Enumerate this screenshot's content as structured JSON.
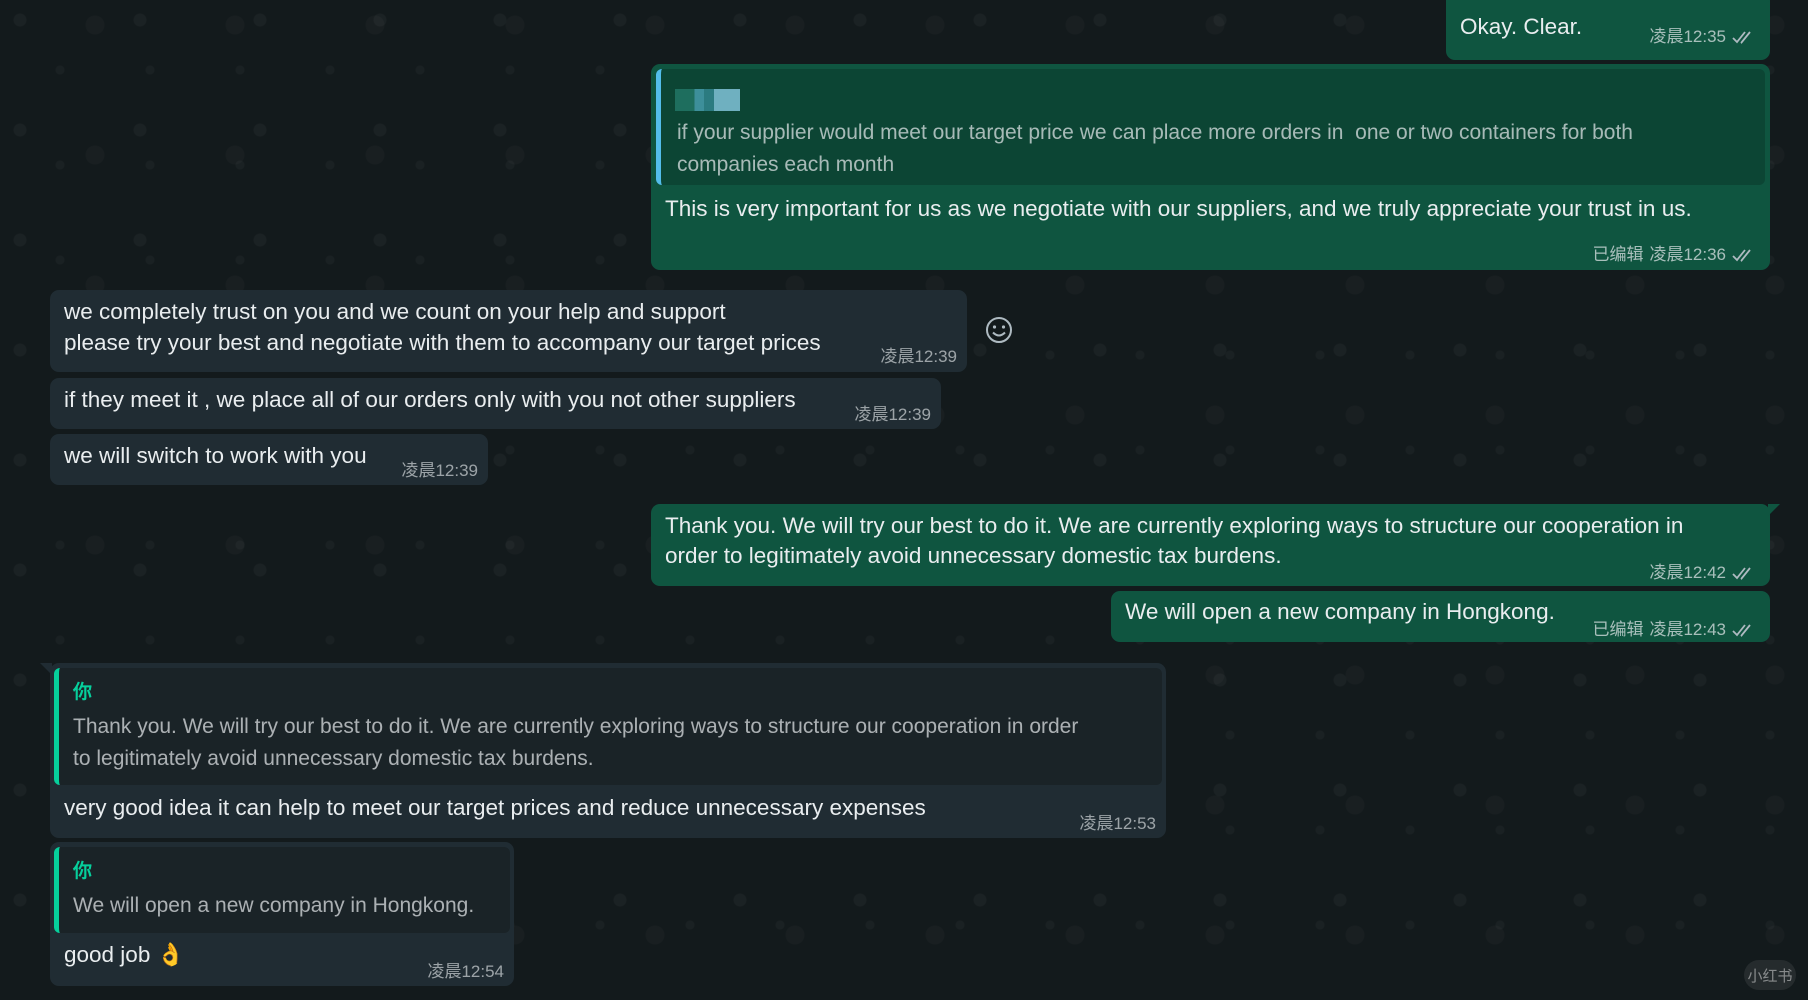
{
  "messages": [
    {
      "id": "m1",
      "direction": "out",
      "text": "Okay. Clear.",
      "time": "凌晨12:35",
      "read": true
    },
    {
      "id": "m2",
      "direction": "out",
      "quote": {
        "text_line1": "if your supplier would meet our target price we can place more orders in  one or two containers for both",
        "text_line2": "companies each month"
      },
      "text": "This is very important for us as we negotiate with our suppliers, and we truly appreciate your trust in us.",
      "edited": "已编辑",
      "time": "凌晨12:36",
      "read": true
    },
    {
      "id": "m3",
      "direction": "in",
      "text_line1": "we completely trust on you and we count on your help and support",
      "text_line2": "please try your best and negotiate with them to accompany our target prices",
      "time": "凌晨12:39"
    },
    {
      "id": "m4",
      "direction": "in",
      "text": "if they meet it , we place all of our orders only with you not other suppliers",
      "time": "凌晨12:39"
    },
    {
      "id": "m5",
      "direction": "in",
      "text": "we will switch to work with you",
      "time": "凌晨12:39"
    },
    {
      "id": "m6",
      "direction": "out",
      "text_line1": "Thank you. We will try our best to do it. We are currently exploring ways to structure our cooperation in",
      "text_line2": "order to legitimately avoid unnecessary domestic tax burdens.",
      "time": "凌晨12:42",
      "read": true
    },
    {
      "id": "m7",
      "direction": "out",
      "text": "We will open a new company in Hongkong.",
      "edited": "已编辑",
      "time": "凌晨12:43",
      "read": true
    },
    {
      "id": "m8",
      "direction": "in",
      "quote": {
        "author": "你",
        "text_line1": "Thank you. We will try our best to do it. We are currently exploring ways to structure our cooperation in order",
        "text_line2": "to legitimately avoid unnecessary domestic tax burdens."
      },
      "text": "very good idea it can help to meet our target prices and reduce unnecessary expenses",
      "time": "凌晨12:53"
    },
    {
      "id": "m9",
      "direction": "in",
      "quote": {
        "author": "你",
        "text_line1": "We will open a new company in Hongkong."
      },
      "text": "good job 👌",
      "time": "凌晨12:54"
    }
  ],
  "icons": {
    "reaction": "smiley-icon",
    "read_receipt": "double-check-icon"
  },
  "watermark": "小红书",
  "colors": {
    "background": "#131a1c",
    "incoming": "#202c33",
    "outgoing": "#0f5540",
    "quote_accent": "#06cf9c",
    "quote_accent_out": "#53bdeb"
  }
}
